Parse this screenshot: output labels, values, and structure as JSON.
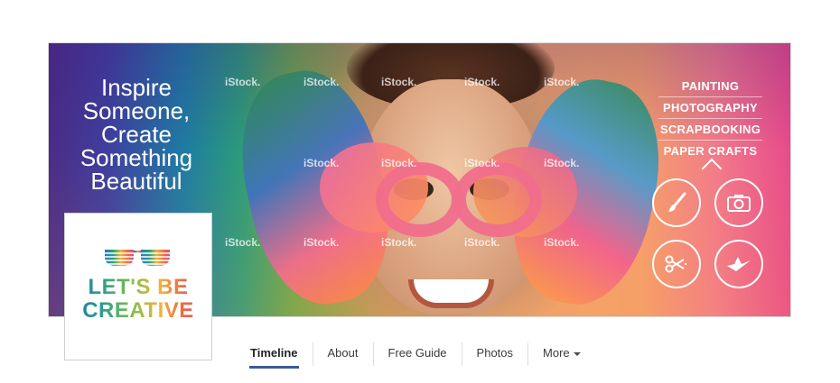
{
  "cover": {
    "tagline": [
      "Inspire",
      "Someone,",
      "Create",
      "Something",
      "Beautiful"
    ],
    "menu_items": [
      "PAINTING",
      "PHOTOGRAPHY",
      "SCRAPBOOKING",
      "PAPER CRAFTS"
    ],
    "watermark": "iStock.",
    "icons": [
      "paintbrush-icon",
      "camera-icon",
      "scissors-icon",
      "paper-craft-icon"
    ]
  },
  "profile": {
    "logo_line1": "LET'S BE",
    "logo_line2": "CREATIVE"
  },
  "nav": {
    "tabs": [
      {
        "label": "Timeline",
        "active": true
      },
      {
        "label": "About"
      },
      {
        "label": "Free Guide"
      },
      {
        "label": "Photos"
      },
      {
        "label": "More"
      }
    ]
  },
  "colors": {
    "accent": "#3b5998",
    "text": "#1d2129"
  }
}
